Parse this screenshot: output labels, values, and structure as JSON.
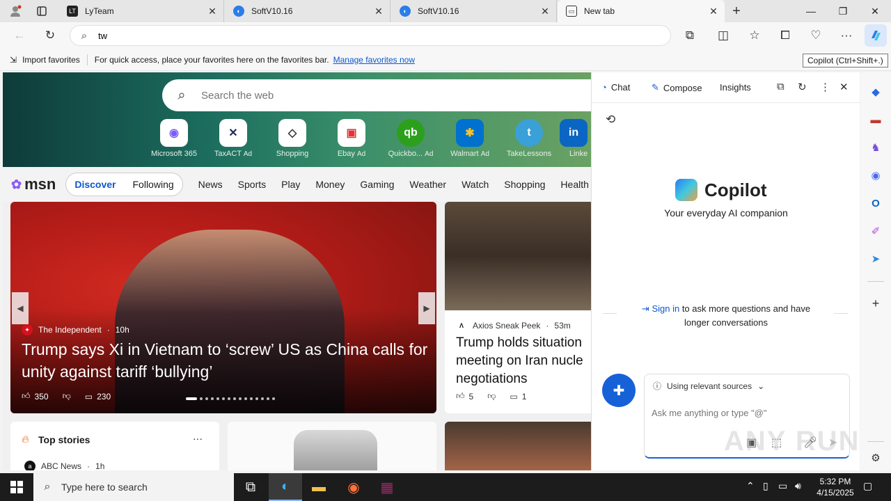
{
  "tabs": [
    {
      "title": "LyTeam",
      "favicon": "lyteam-icon"
    },
    {
      "title": "SoftV10.16",
      "favicon": "edge-blue-icon"
    },
    {
      "title": "SoftV10.16",
      "favicon": "edge-blue-icon"
    },
    {
      "title": "New tab",
      "favicon": "newtab-icon",
      "active": true
    }
  ],
  "address_bar": {
    "value": "tw"
  },
  "favorites_bar": {
    "import_label": "Import favorites",
    "message": "For quick access, place your favorites here on the favorites bar.",
    "manage_link": "Manage favorites now"
  },
  "tooltip": "Copilot (Ctrl+Shift+.)",
  "msn": {
    "search_placeholder": "Search the web",
    "quick_links": [
      {
        "label": "Microsoft 365",
        "ad": ""
      },
      {
        "label": "TaxACT",
        "ad": "Ad"
      },
      {
        "label": "Shopping",
        "ad": ""
      },
      {
        "label": "Ebay",
        "ad": "Ad"
      },
      {
        "label": "Quickbo...",
        "ad": "Ad"
      },
      {
        "label": "Walmart",
        "ad": "Ad"
      },
      {
        "label": "TakeLessons",
        "ad": ""
      },
      {
        "label": "Linke",
        "ad": ""
      }
    ],
    "logo_text": "msn",
    "pill": {
      "discover": "Discover",
      "following": "Following"
    },
    "nav": [
      "News",
      "Sports",
      "Play",
      "Money",
      "Gaming",
      "Weather",
      "Watch",
      "Shopping",
      "Health"
    ],
    "main_story": {
      "source": "The Independent",
      "age": "10h",
      "title": "Trump says Xi in Vietnam to ‘screw’ US as China calls for unity against tariff ‘bullying’",
      "likes": "350",
      "comments": "230"
    },
    "side_story": {
      "source": "Axios Sneak Peek",
      "age": "53m",
      "title_lines": [
        "Trump holds situation",
        "meeting on Iran nucle",
        "negotiations"
      ],
      "likes": "5",
      "comments": "1"
    },
    "top_stories": {
      "title": "Top stories",
      "more": "···",
      "first_source": "ABC News",
      "first_age": "1h"
    }
  },
  "copilot": {
    "tabs": [
      "Chat",
      "Compose",
      "Insights"
    ],
    "brand": "Copilot",
    "subtitle": "Your everyday AI companion",
    "signin_link": "Sign in",
    "signin_text_1": "to ask more questions and have",
    "signin_text_2": "longer conversations",
    "sources_label": "Using relevant sources",
    "input_placeholder": "Ask me anything or type \"@\""
  },
  "taskbar": {
    "search_placeholder": "Type here to search",
    "time": "5:32 PM",
    "date": "4/15/2025"
  },
  "watermark": "ANY RUN"
}
